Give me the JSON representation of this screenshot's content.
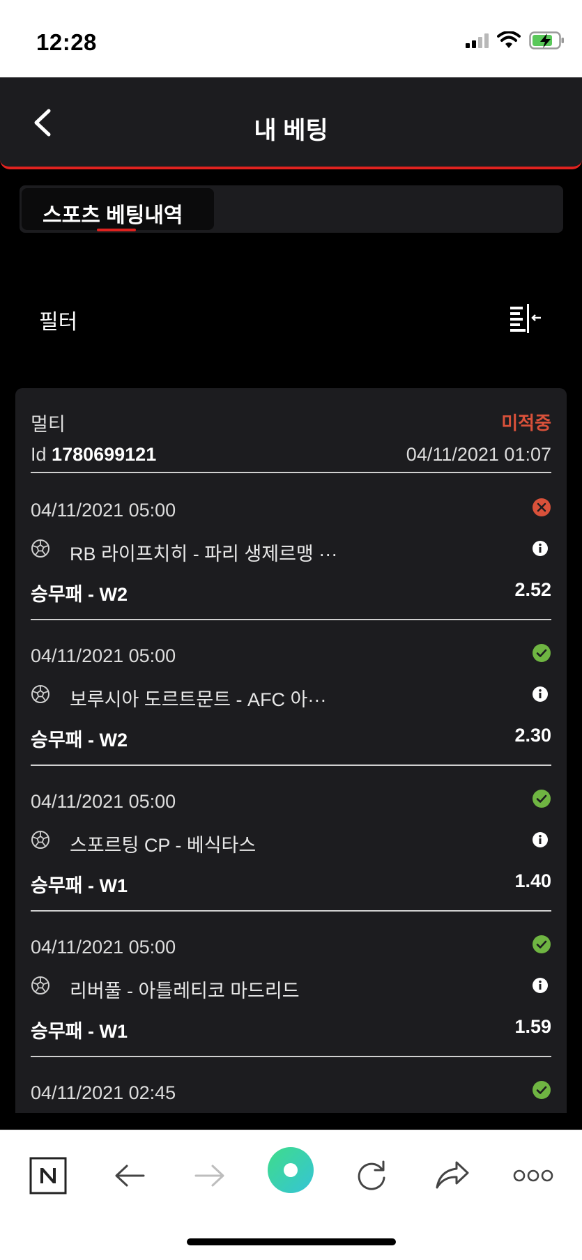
{
  "status_bar": {
    "time": "12:28"
  },
  "header": {
    "title": "내 베팅"
  },
  "tabs": [
    {
      "label": "스포츠 베팅내역",
      "active": true
    }
  ],
  "filter": {
    "label": "필터"
  },
  "bet": {
    "type": "멀티",
    "status": "미적중",
    "id_label": "Id",
    "id_value": "1780699121",
    "placed": "04/11/2021 01:07",
    "selections": [
      {
        "time": "04/11/2021 05:00",
        "result": "lost",
        "sport": "soccer-ball",
        "match": "RB 라이프치히 - 파리 생제르맹 ···",
        "market": "승무패 - W2",
        "odds": "2.52"
      },
      {
        "time": "04/11/2021 05:00",
        "result": "won",
        "sport": "soccer-ball",
        "match": "보루시아 도르트문트 - AFC 아···",
        "market": "승무패 - W2",
        "odds": "2.30"
      },
      {
        "time": "04/11/2021 05:00",
        "result": "won",
        "sport": "soccer-ball",
        "match": "스포르팅 CP - 베식타스",
        "market": "승무패 - W1",
        "odds": "1.40"
      },
      {
        "time": "04/11/2021 05:00",
        "result": "won",
        "sport": "soccer-ball",
        "match": "리버풀 - 아틀레티코 마드리드",
        "market": "승무패 - W1",
        "odds": "1.59"
      },
      {
        "time": "04/11/2021 02:45",
        "result": "won",
        "sport": "soccer-ball",
        "match": "",
        "market": "",
        "odds": ""
      }
    ]
  },
  "colors": {
    "accent_red": "#e0221f",
    "status_lost": "#d9513a",
    "status_won": "#6fb542",
    "card_bg": "#1c1c1f"
  },
  "browser_toolbar": {
    "icons": [
      "naver-icon",
      "back-arrow-icon",
      "forward-arrow-icon",
      "green-dot-icon",
      "reload-icon",
      "share-icon",
      "more-icon"
    ]
  }
}
